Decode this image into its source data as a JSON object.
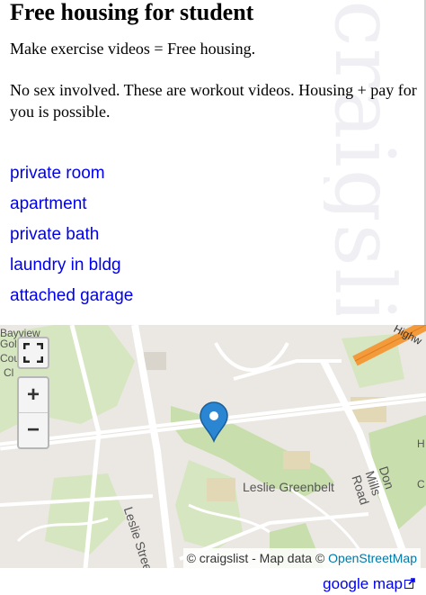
{
  "posting": {
    "title": "Free housing for student",
    "body_line_1": "Make exercise videos = Free housing.",
    "body_line_2": "No sex involved. These are workout videos. Housing + pay for you is possible."
  },
  "attributes": [
    "private room",
    "apartment",
    "private bath",
    "laundry in bldg",
    "attached garage"
  ],
  "watermark": "craigslist",
  "map": {
    "labels": {
      "bayview": "Bayview",
      "golf": "Golf",
      "cou": "Cou",
      "cl": "Cl",
      "highway": "Highw",
      "leslie_street": "Leslie Street",
      "leslie_greenbelt": "Leslie Greenbelt",
      "don_mills": "Don Mills Road",
      "h_edge": "H",
      "c_edge": "C"
    },
    "controls": {
      "fullscreen": "⛶",
      "zoom_in": "+",
      "zoom_out": "−"
    },
    "attribution_prefix": "© craigslist - Map data ©",
    "attribution_link": "OpenStreetMap",
    "colors": {
      "park": "#c8dfad",
      "road": "#ffffff",
      "highway": "#f39a3a",
      "marker": "#2a86d3"
    }
  },
  "google_map_link": "google map"
}
